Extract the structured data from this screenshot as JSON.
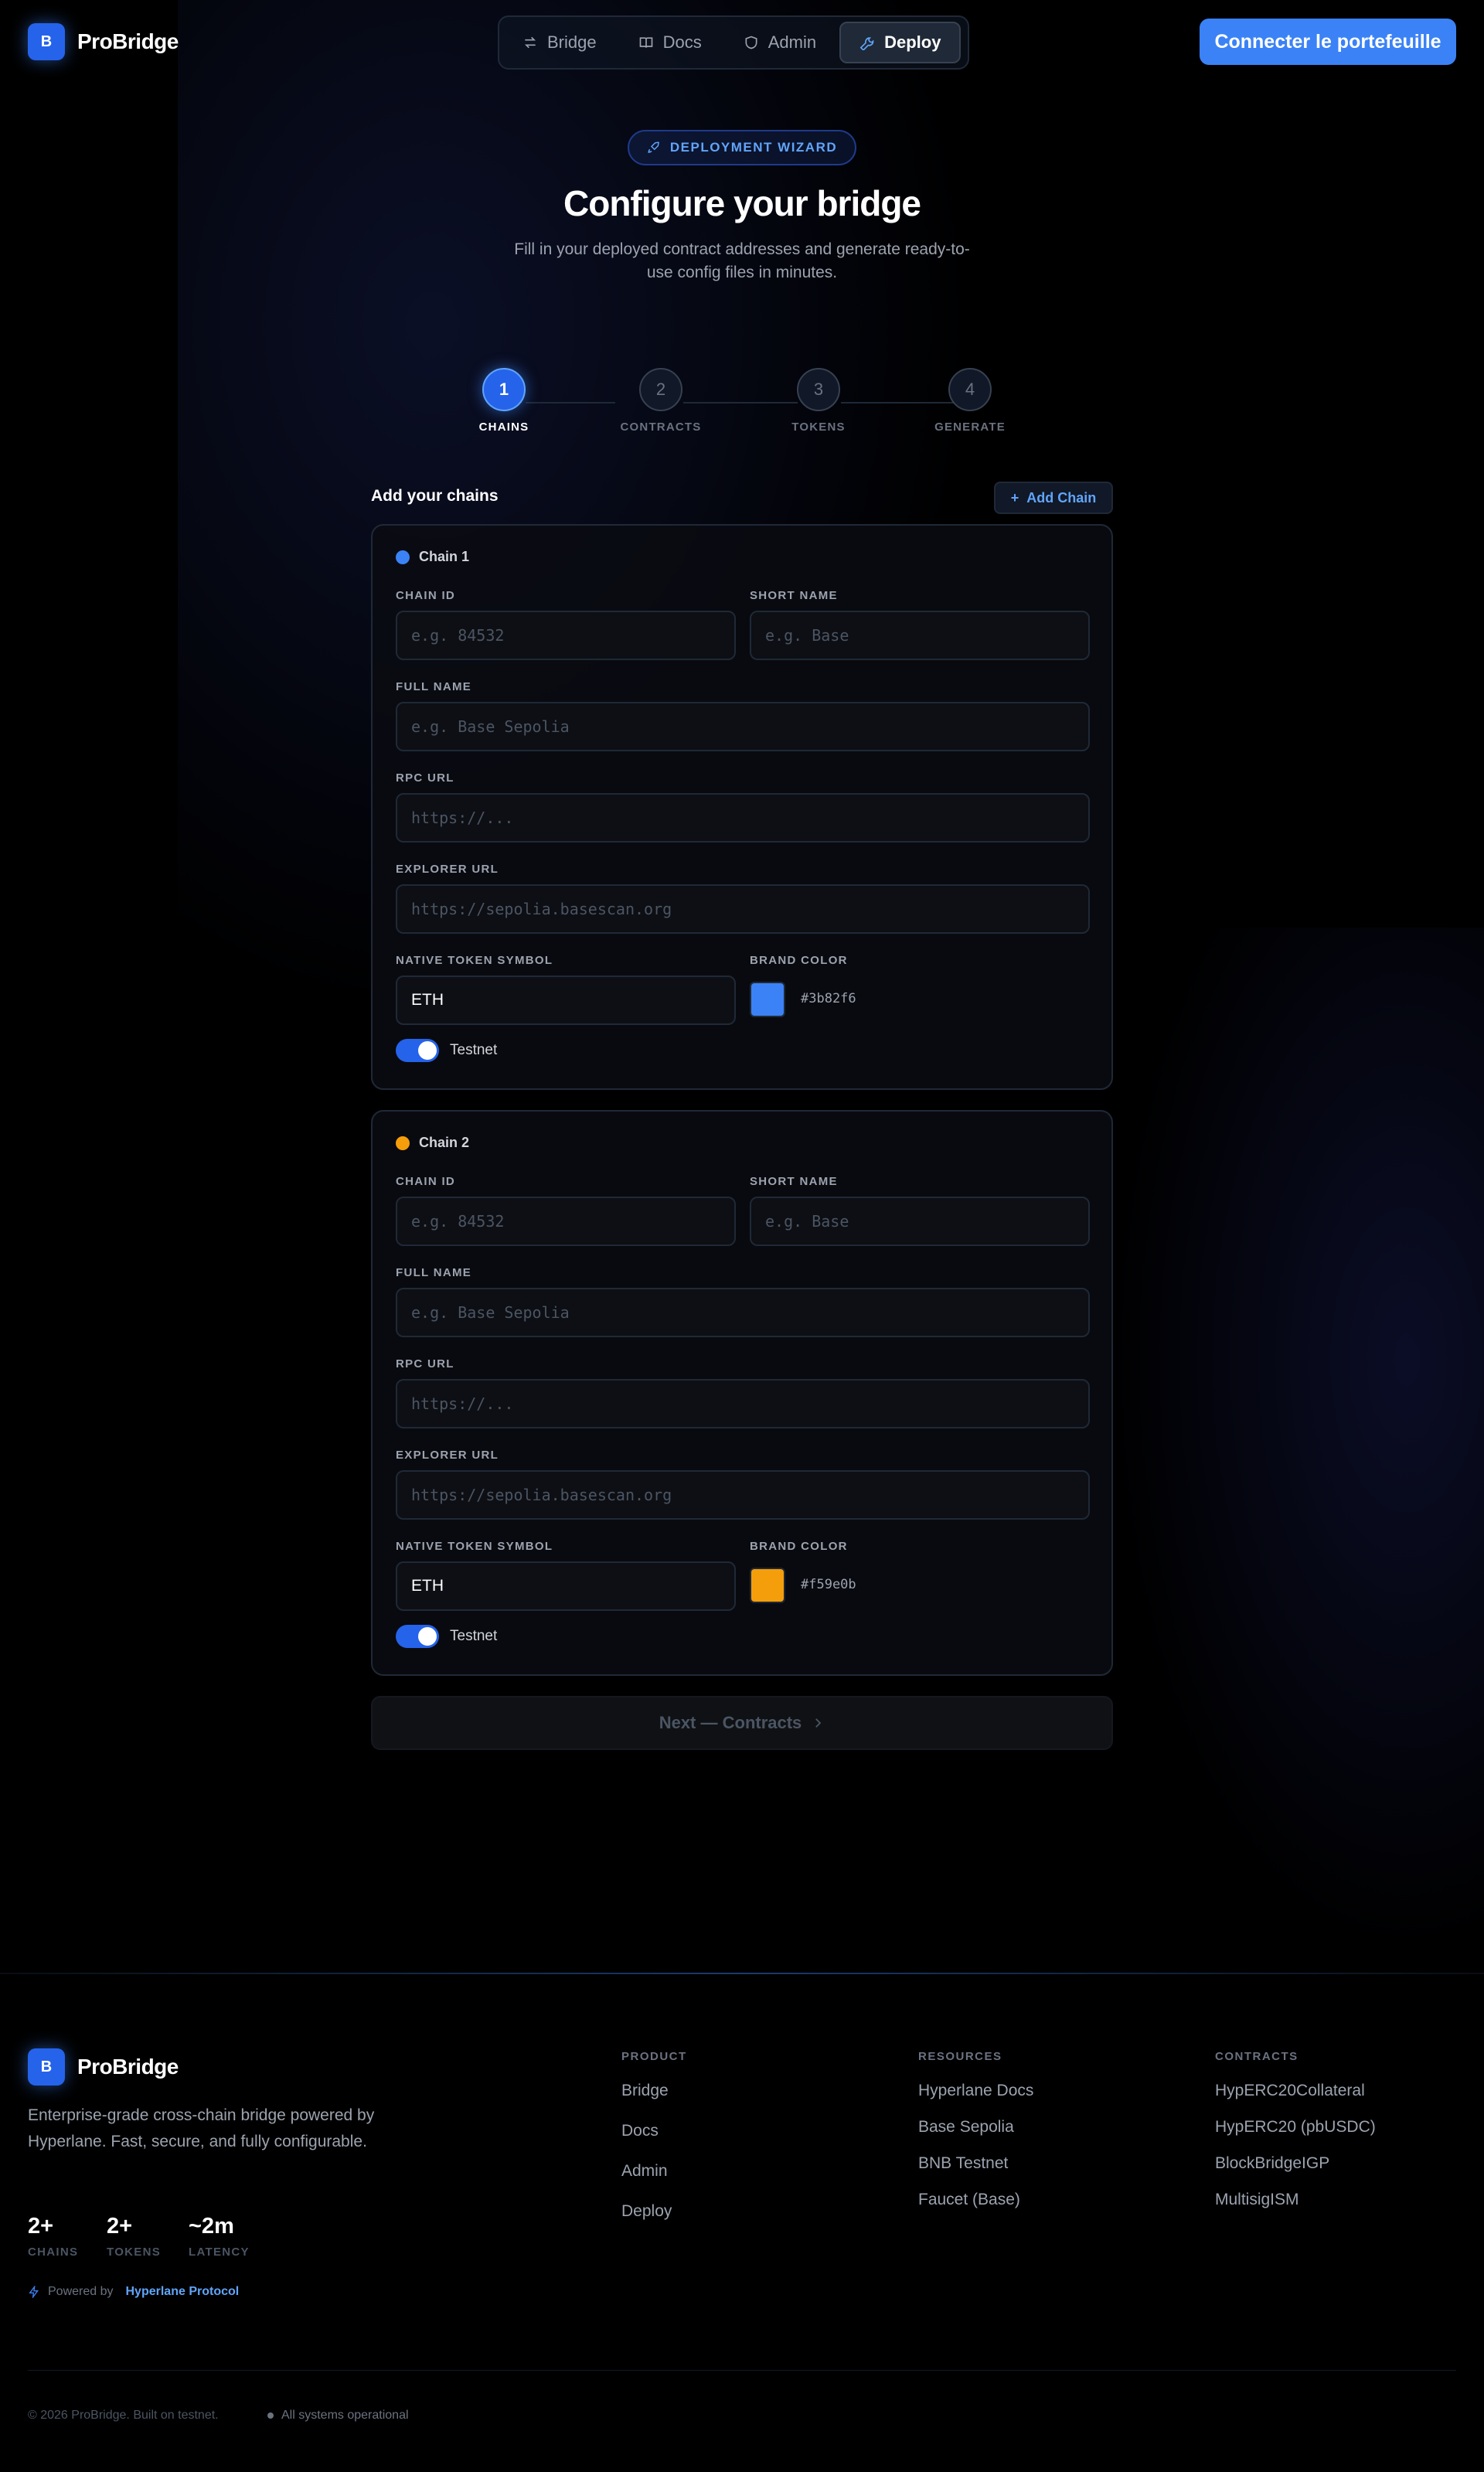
{
  "header": {
    "logo_letter": "B",
    "brand": "ProBridge",
    "nav": [
      {
        "label": "Bridge",
        "icon": "arrows-swap-icon"
      },
      {
        "label": "Docs",
        "icon": "book-icon"
      },
      {
        "label": "Admin",
        "icon": "shield-icon"
      },
      {
        "label": "Deploy",
        "icon": "wrench-icon"
      }
    ],
    "active_nav": "Deploy",
    "connect_label": "Connecter le portefeuille"
  },
  "hero": {
    "badge": "DEPLOYMENT WIZARD",
    "title": "Configure your bridge",
    "subtitle": "Fill in your deployed contract addresses and generate ready-to-use config files in minutes."
  },
  "stepper": [
    {
      "num": "1",
      "label": "CHAINS",
      "active": true
    },
    {
      "num": "2",
      "label": "CONTRACTS",
      "active": false
    },
    {
      "num": "3",
      "label": "TOKENS",
      "active": false
    },
    {
      "num": "4",
      "label": "GENERATE",
      "active": false
    }
  ],
  "form": {
    "section_title": "Add your chains",
    "add_chain_label": "Add Chain",
    "labels": {
      "chain_id": "CHAIN ID",
      "short_name": "SHORT NAME",
      "full_name": "FULL NAME",
      "rpc_url": "RPC URL",
      "explorer_url": "EXPLORER URL",
      "native_token": "NATIVE TOKEN SYMBOL",
      "brand_color": "BRAND COLOR",
      "testnet": "Testnet"
    },
    "placeholders": {
      "chain_id": "e.g. 84532",
      "short_name": "e.g. Base",
      "full_name": "e.g. Base Sepolia",
      "rpc_url": "https://...",
      "explorer_url": "https://sepolia.basescan.org"
    },
    "chains": [
      {
        "name": "Chain 1",
        "native_token": "ETH",
        "color": "#3b82f6",
        "testnet": true
      },
      {
        "name": "Chain 2",
        "native_token": "ETH",
        "color": "#f59e0b",
        "testnet": true
      }
    ],
    "next_label": "Next — Contracts"
  },
  "footer": {
    "logo_letter": "B",
    "brand": "ProBridge",
    "description": "Enterprise-grade cross-chain bridge powered by Hyperlane. Fast, secure, and fully configurable.",
    "stats": [
      {
        "value": "2+",
        "label": "CHAINS"
      },
      {
        "value": "2+",
        "label": "TOKENS"
      },
      {
        "value": "~2m",
        "label": "LATENCY"
      }
    ],
    "powered_by": "Powered by",
    "powered_link": "Hyperlane Protocol",
    "columns": [
      {
        "title": "PRODUCT",
        "items": [
          "Bridge",
          "Docs",
          "Admin",
          "Deploy"
        ]
      },
      {
        "title": "RESOURCES",
        "items": [
          "Hyperlane Docs",
          "Base Sepolia",
          "BNB Testnet",
          "Faucet (Base)"
        ]
      },
      {
        "title": "CONTRACTS",
        "items": [
          "HypERC20Collateral",
          "HypERC20 (pbUSDC)",
          "BlockBridgeIGP",
          "MultisigISM"
        ]
      }
    ],
    "copyright": "© 2026 ProBridge. Built on testnet.",
    "status": "All systems operational"
  }
}
